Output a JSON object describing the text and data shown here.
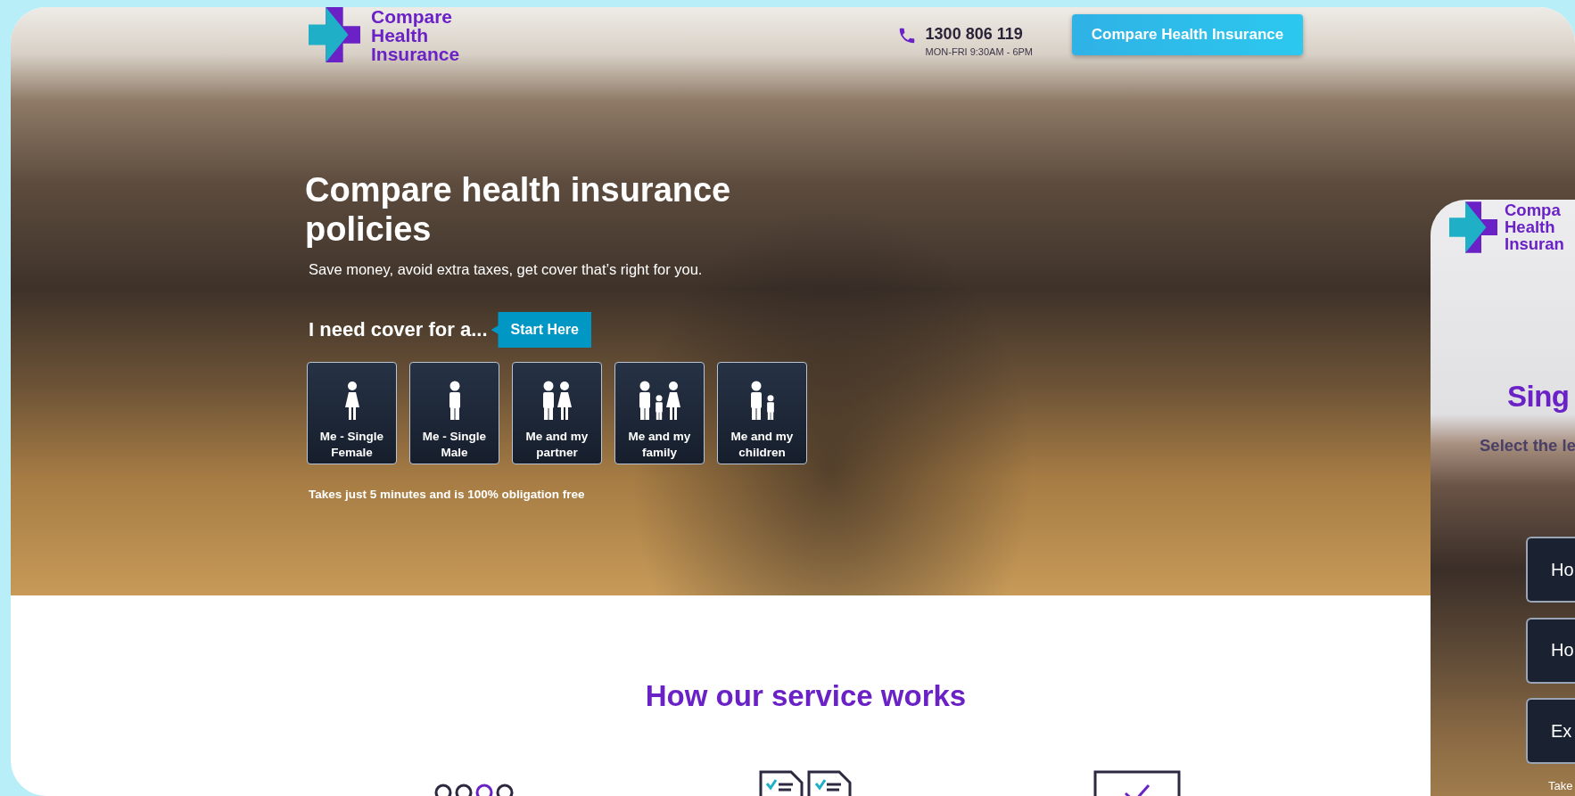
{
  "header": {
    "logo_lines": [
      "Compare",
      "Health",
      "Insurance"
    ],
    "phone": "1300 806 119",
    "hours": "MON-FRI 9:30AM - 6PM",
    "cta": "Compare Health Insurance"
  },
  "hero": {
    "title": "Compare health insurance policies",
    "subtitle": "Save money, avoid extra taxes, get cover that’s right for you.",
    "prompt": "I need cover for a...",
    "badge": "Start Here",
    "options": [
      {
        "kind": "female",
        "label": "Me - Single Female"
      },
      {
        "kind": "male",
        "label": "Me - Single Male"
      },
      {
        "kind": "couple",
        "label": "Me and my partner"
      },
      {
        "kind": "family",
        "label": "Me and my family"
      },
      {
        "kind": "parent_child",
        "label": "Me and my children"
      }
    ],
    "note": "Takes just 5 minutes and is 100% obligation free"
  },
  "how_it_works": {
    "title": "How our service works",
    "steps": [
      {
        "kind": "dots"
      },
      {
        "kind": "documents"
      },
      {
        "kind": "checkbox"
      }
    ]
  },
  "second_screen": {
    "logo_lines": [
      "Compa",
      "Health",
      "Insuran"
    ],
    "title": "Sing",
    "subtitle": "Select the le",
    "options": [
      "Ho",
      "Ho",
      "Ex"
    ],
    "note": "Take"
  }
}
